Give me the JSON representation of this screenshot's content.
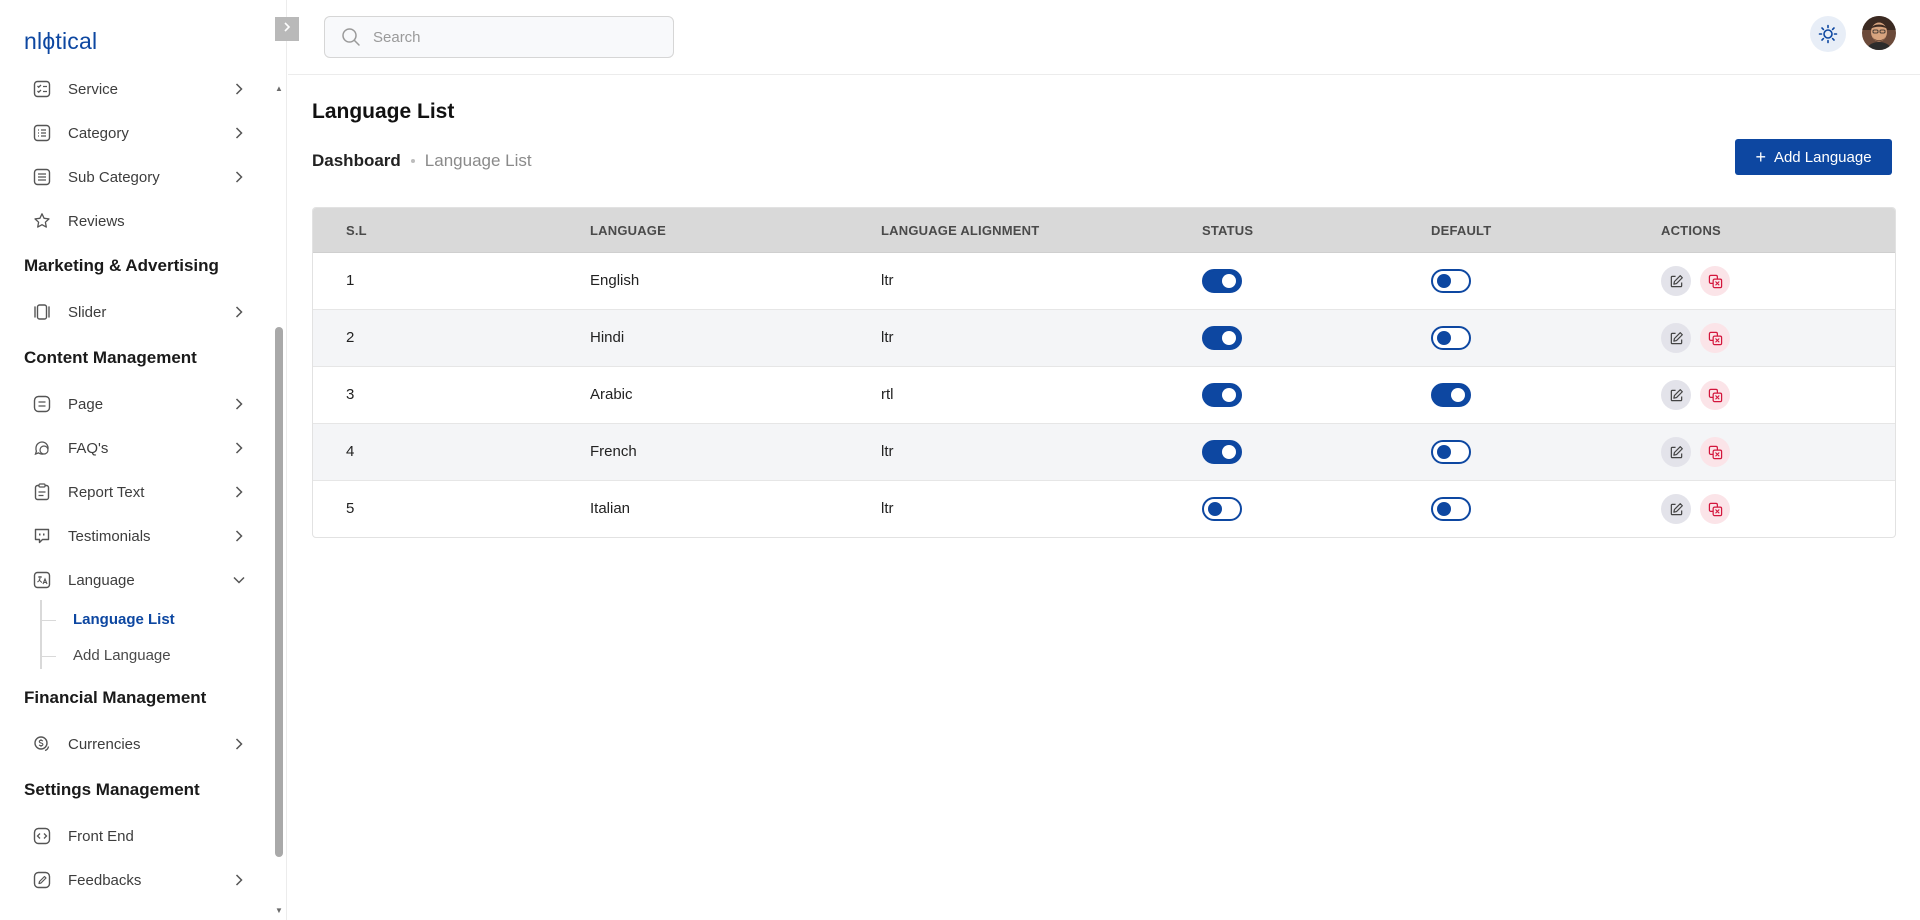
{
  "app": {
    "logo_text": "nlϕtical",
    "brand_color": "#0d47a1"
  },
  "sidebar": {
    "items_top": [
      {
        "label": "Service",
        "icon": "list-check-icon"
      },
      {
        "label": "Category",
        "icon": "list-box-icon"
      },
      {
        "label": "Sub Category",
        "icon": "list-lines-icon"
      },
      {
        "label": "Reviews",
        "icon": "star-icon"
      }
    ],
    "section_marketing": "Marketing & Advertising",
    "slider_label": "Slider",
    "section_content": "Content Management",
    "content_items": [
      {
        "label": "Page",
        "icon": "page-icon"
      },
      {
        "label": "FAQ's",
        "icon": "faq-icon"
      },
      {
        "label": "Report Text",
        "icon": "report-icon"
      },
      {
        "label": "Testimonials",
        "icon": "testimonial-icon"
      },
      {
        "label": "Language",
        "icon": "language-icon"
      }
    ],
    "language_sub": {
      "list": "Language List",
      "add": "Add Language"
    },
    "section_financial": "Financial Management",
    "currencies_label": "Currencies",
    "section_settings": "Settings Management",
    "settings_items": [
      {
        "label": "Front End",
        "icon": "code-icon"
      },
      {
        "label": "Feedbacks",
        "icon": "feedback-icon"
      }
    ]
  },
  "header": {
    "search_placeholder": "Search"
  },
  "main": {
    "title": "Language List",
    "breadcrumb": {
      "home": "Dashboard",
      "current": "Language List"
    },
    "add_button": "Add Language",
    "table": {
      "headers": [
        "S.L",
        "LANGUAGE",
        "LANGUAGE ALIGNMENT",
        "STATUS",
        "DEFAULT",
        "ACTIONS"
      ],
      "rows": [
        {
          "sl": "1",
          "language": "English",
          "alignment": "ltr",
          "status": true,
          "default": false
        },
        {
          "sl": "2",
          "language": "Hindi",
          "alignment": "ltr",
          "status": true,
          "default": false
        },
        {
          "sl": "3",
          "language": "Arabic",
          "alignment": "rtl",
          "status": true,
          "default": true
        },
        {
          "sl": "4",
          "language": "French",
          "alignment": "ltr",
          "status": true,
          "default": false
        },
        {
          "sl": "5",
          "language": "Italian",
          "alignment": "ltr",
          "status": false,
          "default": false
        }
      ]
    }
  }
}
